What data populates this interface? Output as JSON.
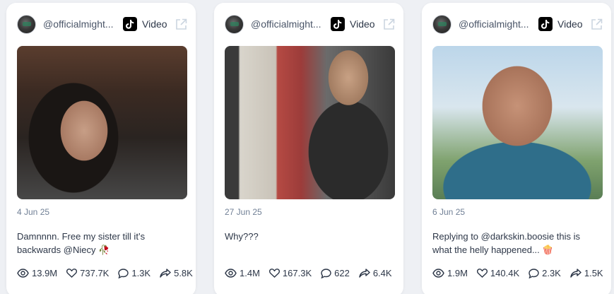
{
  "cards": [
    {
      "handle": "@officialmight...",
      "type_label": "Video",
      "date": "4 Jun 25",
      "caption": "Damnnnn. Free my sister till it’s backwards @Niecy 🥀",
      "stats": {
        "views": "13.9M",
        "likes": "737.7K",
        "comments": "1.3K",
        "shares": "5.8K"
      }
    },
    {
      "handle": "@officialmight...",
      "type_label": "Video",
      "date": "27 Jun 25",
      "caption": "Why???",
      "stats": {
        "views": "1.4M",
        "likes": "167.3K",
        "comments": "622",
        "shares": "6.4K"
      }
    },
    {
      "handle": "@officialmight...",
      "type_label": "Video",
      "date": "6 Jun 25",
      "caption": "Replying to @darkskin.boosie this is what the helly happened... 🍿",
      "stats": {
        "views": "1.9M",
        "likes": "140.4K",
        "comments": "2.3K",
        "shares": "1.5K"
      }
    }
  ],
  "icons": {
    "platform": "tiktok-icon",
    "open_external": "external-link-icon",
    "views": "eye-icon",
    "likes": "heart-icon",
    "comments": "comment-icon",
    "shares": "share-icon"
  },
  "colors": {
    "background": "#eef0f4",
    "card": "#ffffff",
    "text_primary": "#2d3748",
    "text_muted": "#718096",
    "icon_muted": "#cbd5e0"
  }
}
